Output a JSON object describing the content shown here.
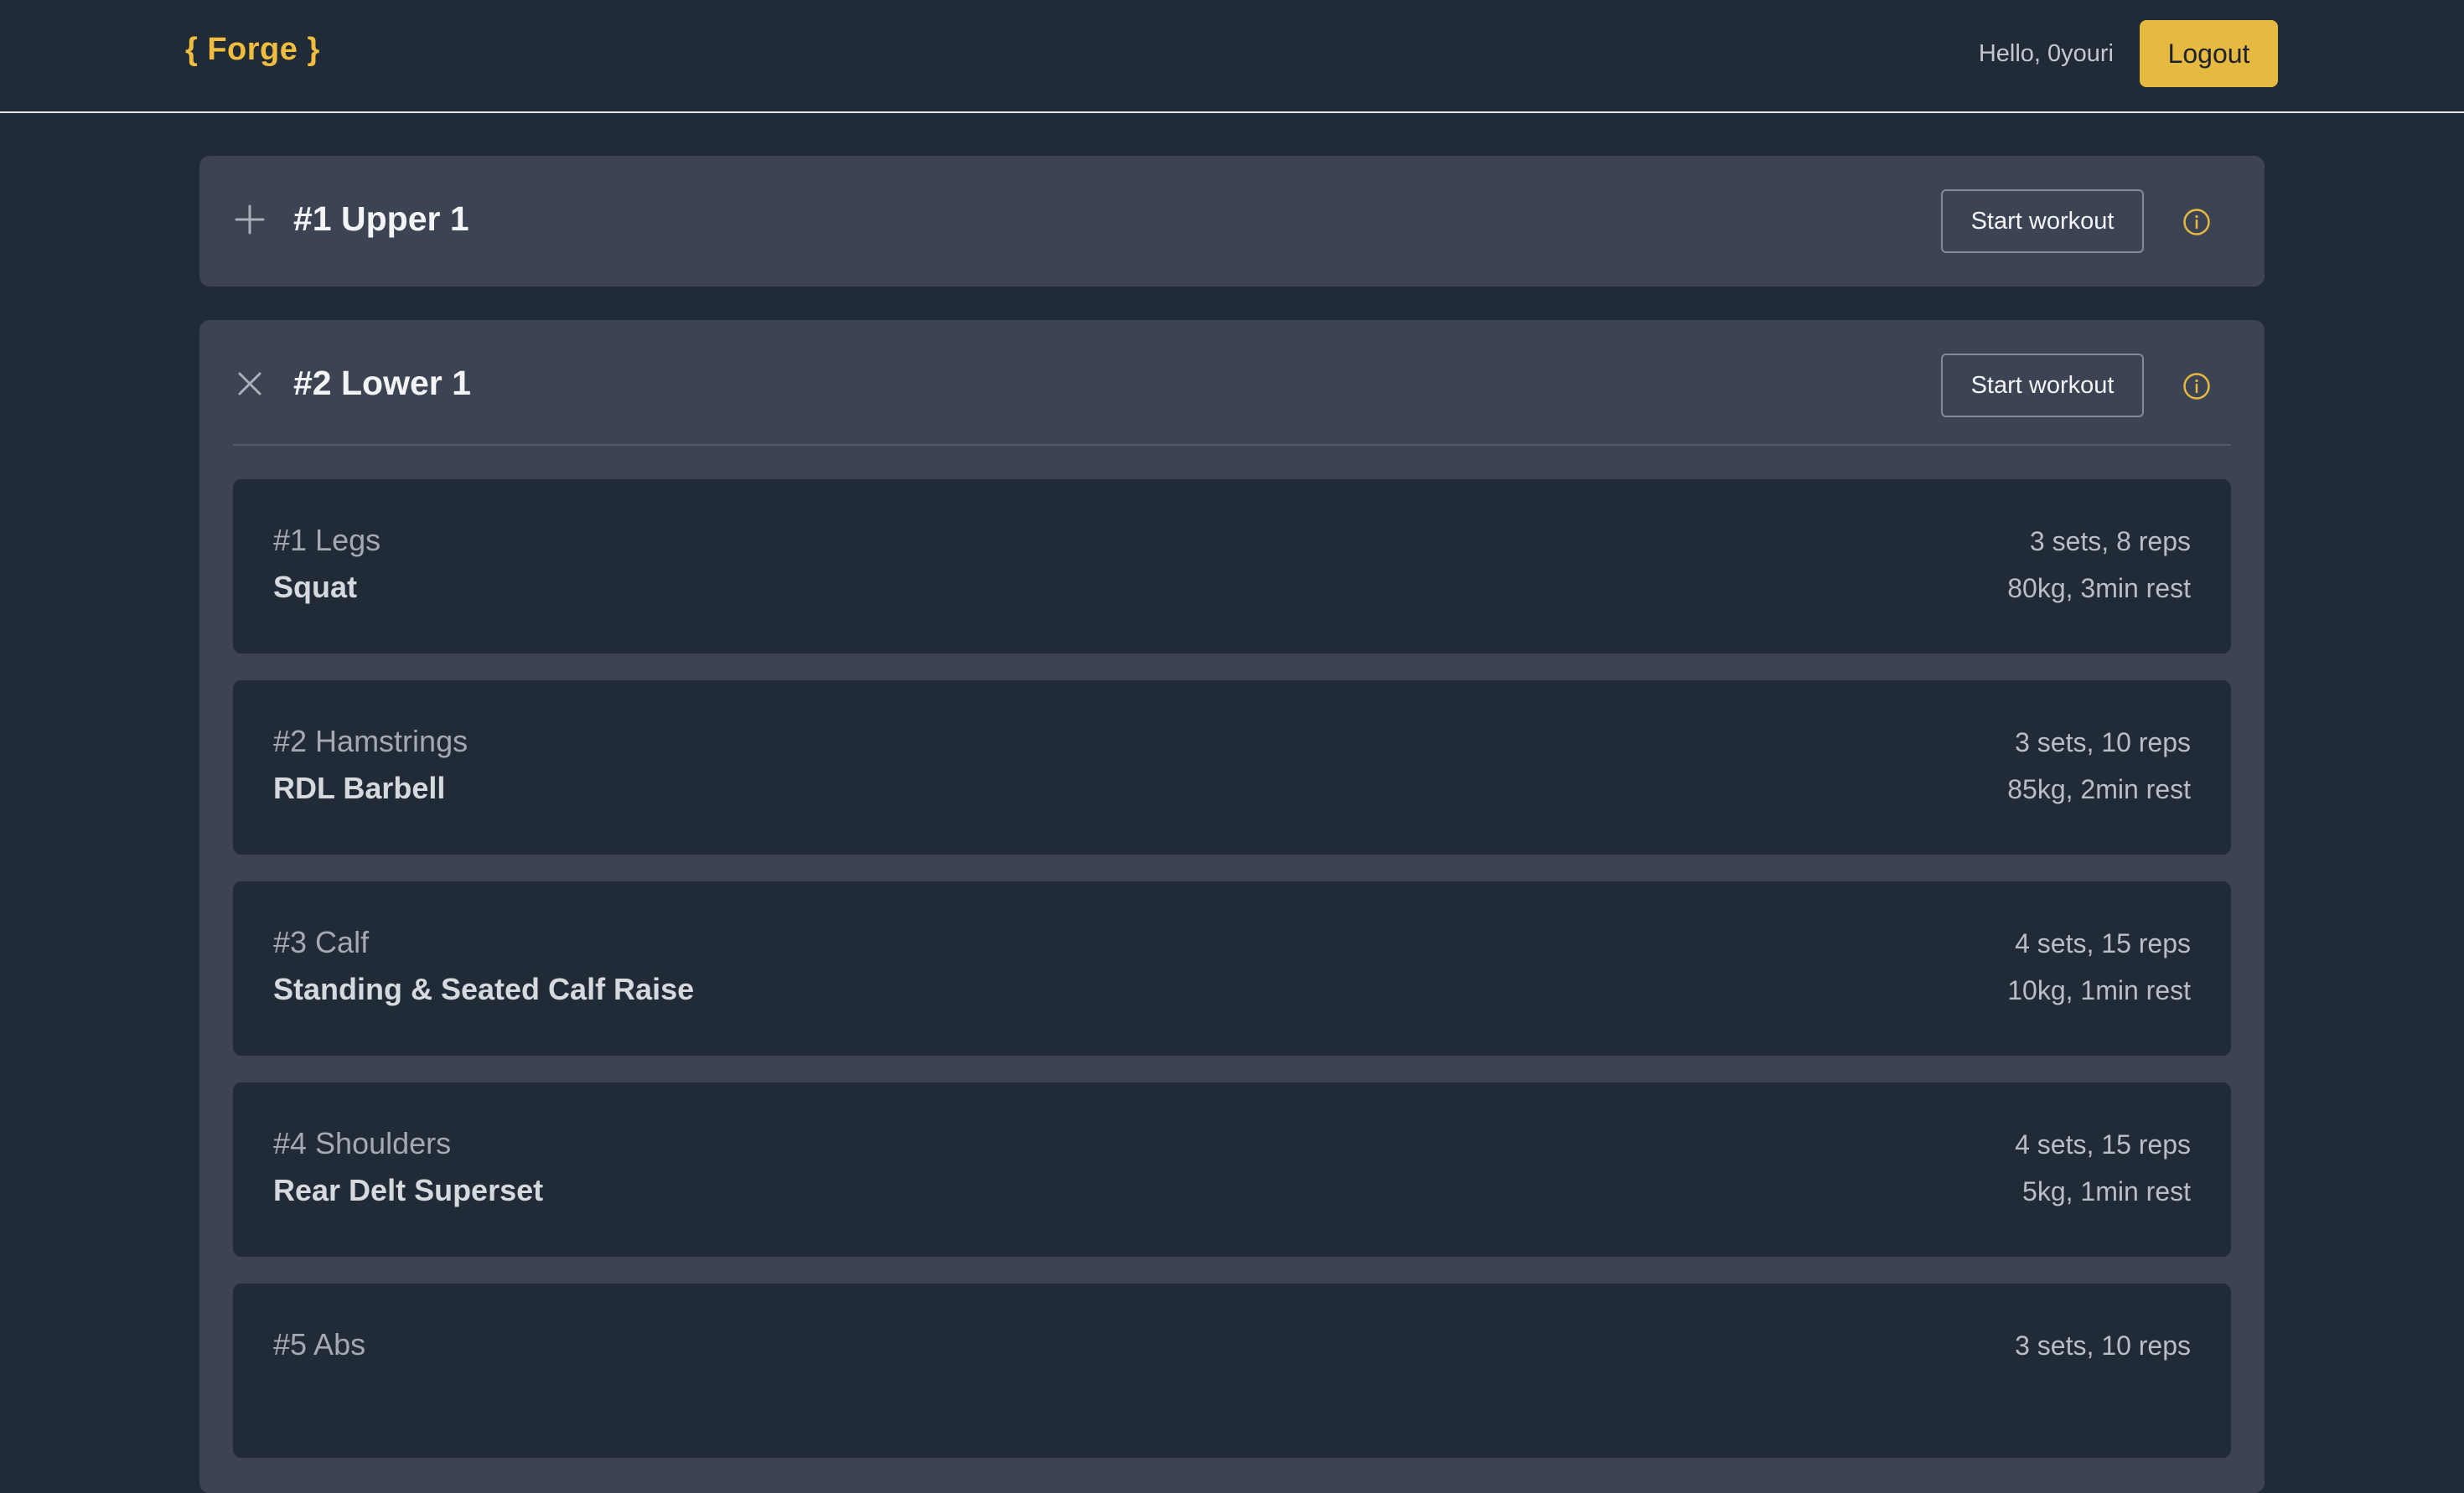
{
  "header": {
    "logo": "{ Forge }",
    "greeting": "Hello, 0youri",
    "logout_label": "Logout"
  },
  "colors": {
    "background": "#212a37",
    "panel": "#3c4353",
    "accent": "#e6b941"
  },
  "workouts": [
    {
      "title": "#1 Upper 1",
      "toggle_icon": "plus-icon",
      "start_label": "Start workout",
      "expanded": false
    },
    {
      "title": "#2 Lower 1",
      "toggle_icon": "close-icon",
      "start_label": "Start workout",
      "expanded": true,
      "exercises": [
        {
          "category": "#1 Legs",
          "name": "Squat",
          "sets": "3 sets, 8 reps",
          "load": "80kg, 3min rest"
        },
        {
          "category": "#2 Hamstrings",
          "name": "RDL Barbell",
          "sets": "3 sets, 10 reps",
          "load": "85kg, 2min rest"
        },
        {
          "category": "#3 Calf",
          "name": "Standing & Seated Calf Raise",
          "sets": "4 sets, 15 reps",
          "load": "10kg, 1min rest"
        },
        {
          "category": "#4 Shoulders",
          "name": "Rear Delt Superset",
          "sets": "4 sets, 15 reps",
          "load": "5kg, 1min rest"
        },
        {
          "category": "#5 Abs",
          "name": "",
          "sets": "3 sets, 10 reps",
          "load": ""
        }
      ]
    }
  ]
}
